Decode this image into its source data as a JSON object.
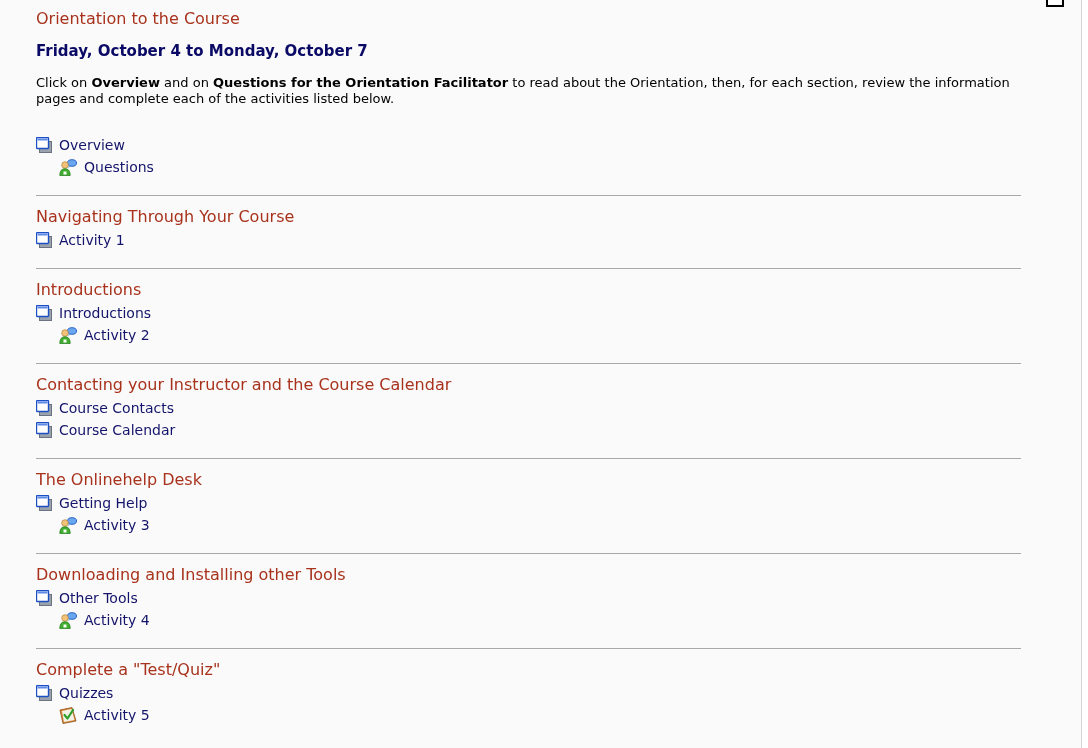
{
  "sections": [
    {
      "title": "Orientation to the Course",
      "subtitle": "Friday, October 4 to Monday, October 7",
      "intro": "Click on **Overview** and on **Questions for the Orientation Facilitator** to read about the Orientation, then, for each section, review the information pages and complete each of the activities listed below.",
      "items": [
        {
          "kind": "page",
          "label": "Overview",
          "children": [
            {
              "kind": "discussion",
              "label": "Questions"
            }
          ]
        }
      ]
    },
    {
      "title": "Navigating Through Your Course",
      "items": [
        {
          "kind": "page",
          "label": "Activity 1"
        }
      ]
    },
    {
      "title": "Introductions",
      "items": [
        {
          "kind": "page",
          "label": "Introductions",
          "children": [
            {
              "kind": "discussion",
              "label": "Activity 2"
            }
          ]
        }
      ]
    },
    {
      "title": "Contacting your Instructor and the Course Calendar",
      "items": [
        {
          "kind": "page",
          "label": "Course Contacts"
        },
        {
          "kind": "page",
          "label": "Course Calendar"
        }
      ]
    },
    {
      "title": "The Onlinehelp Desk",
      "items": [
        {
          "kind": "page",
          "label": "Getting Help",
          "children": [
            {
              "kind": "discussion",
              "label": "Activity 3"
            }
          ]
        }
      ]
    },
    {
      "title": "Downloading and Installing other Tools",
      "items": [
        {
          "kind": "page",
          "label": "Other Tools",
          "children": [
            {
              "kind": "discussion",
              "label": "Activity 4"
            }
          ]
        }
      ]
    },
    {
      "title": "Complete a \"Test/Quiz\"",
      "items": [
        {
          "kind": "page",
          "label": "Quizzes",
          "children": [
            {
              "kind": "quiz",
              "label": "Activity 5"
            }
          ]
        }
      ]
    }
  ]
}
